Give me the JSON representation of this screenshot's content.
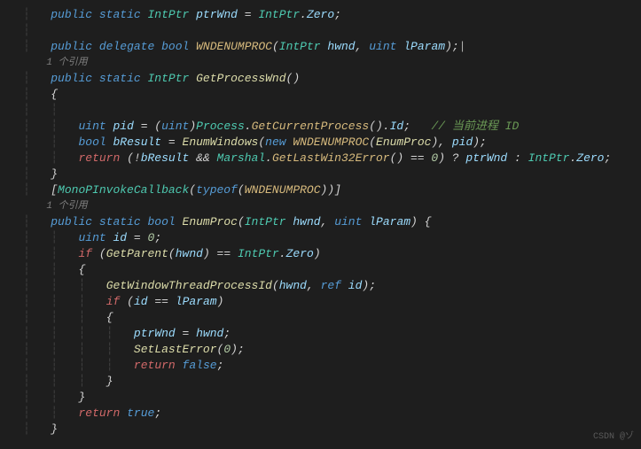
{
  "code": {
    "l1": {
      "kw1": "public",
      "kw2": "static",
      "type": "IntPtr",
      "name": "ptrWnd",
      "eq": " = ",
      "type2": "IntPtr",
      "dot": ".",
      "member": "Zero",
      "semi": ";"
    },
    "l2_blank": "",
    "l3": {
      "kw1": "public",
      "kw2": "delegate",
      "kw3": "bool",
      "name": "WNDENUMPROC",
      "p1type": "IntPtr",
      "p1name": "hwnd",
      "p2type": "uint",
      "p2name": "lParam"
    },
    "l4_hint": "1 个引用",
    "l5": {
      "kw1": "public",
      "kw2": "static",
      "type": "IntPtr",
      "name": "GetProcessWnd"
    },
    "l6_brace": "{",
    "l7_blank": "",
    "l8": {
      "type": "uint",
      "name": "pid",
      "eq": " = (",
      "cast": "uint",
      "cls": "Process",
      "fn": "GetCurrentProcess",
      "prop": "Id",
      "comment": "// 当前进程 ID"
    },
    "l9": {
      "type": "bool",
      "name": "bResult",
      "fn": "EnumWindows",
      "kw": "new",
      "ctor": "WNDENUMPROC",
      "arg1": "EnumProc",
      "arg2": "pid"
    },
    "l10": {
      "kw": "return",
      "var1": "bResult",
      "cls": "Marshal",
      "fn": "GetLastWin32Error",
      "num": "0",
      "var2": "ptrWnd",
      "type": "IntPtr",
      "member": "Zero"
    },
    "l11_brace": "}",
    "l12": {
      "attr": "MonoPInvokeCallback",
      "kw": "typeof",
      "type": "WNDENUMPROC"
    },
    "l13_hint": "1 个引用",
    "l14": {
      "kw1": "public",
      "kw2": "static",
      "kw3": "bool",
      "name": "EnumProc",
      "p1type": "IntPtr",
      "p1name": "hwnd",
      "p2type": "uint",
      "p2name": "lParam"
    },
    "l15": {
      "type": "uint",
      "name": "id",
      "num": "0"
    },
    "l16": {
      "kw": "if",
      "fn": "GetParent",
      "arg": "hwnd",
      "type": "IntPtr",
      "member": "Zero"
    },
    "l17_brace": "{",
    "l18": {
      "fn": "GetWindowThreadProcessId",
      "arg1": "hwnd",
      "kw": "ref",
      "arg2": "id"
    },
    "l19": {
      "kw": "if",
      "var1": "id",
      "var2": "lParam"
    },
    "l20_brace": "{",
    "l21": {
      "var1": "ptrWnd",
      "var2": "hwnd"
    },
    "l22": {
      "fn": "SetLastError",
      "num": "0"
    },
    "l23": {
      "kw": "return",
      "val": "false"
    },
    "l24_brace": "}",
    "l25_brace": "}",
    "l26": {
      "kw": "return",
      "val": "true"
    },
    "l27_brace": "}"
  },
  "watermark": "CSDN @ゾ"
}
